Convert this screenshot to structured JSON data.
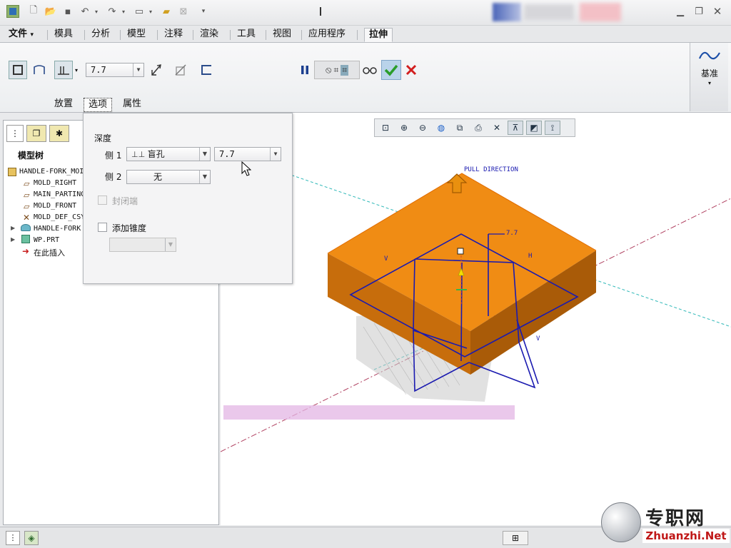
{
  "ribbon_tabs": [
    "文件",
    "模具",
    "分析",
    "模型",
    "注释",
    "渲染",
    "工具",
    "视图",
    "应用程序",
    "拉伸"
  ],
  "file_arrow": "▾",
  "depth_value": "7.7",
  "sub_tabs": [
    "放置",
    "选项",
    "属性"
  ],
  "datum_label": "基准",
  "tree": {
    "title": "模型树",
    "items": [
      "HANDLE-FORK_MOI",
      "MOLD_RIGHT",
      "MAIN_PARTING",
      "MOLD_FRONT",
      "MOLD_DEF_CSY",
      "HANDLE-FORK",
      "WP.PRT",
      "在此插入"
    ]
  },
  "options": {
    "depth_title": "深度",
    "side1_label": "侧 1",
    "side1_type": "盲孔",
    "side1_value": "7.7",
    "side2_label": "侧 2",
    "side2_type": "无",
    "capped_label": "封闭端",
    "taper_label": "添加锥度"
  },
  "viewport": {
    "pull_direction": "PULL DIRECTION",
    "dim_label": "7.7",
    "v_label": "V",
    "h_label": "H"
  },
  "watermark": {
    "cn": "专职网",
    "url": "Zhuanzhi.Net"
  },
  "colors": {
    "orange": "#e8890f",
    "sketch_blue": "#1a1ab0",
    "accept_green": "#2a9d2a",
    "cancel_red": "#d21e1e"
  }
}
